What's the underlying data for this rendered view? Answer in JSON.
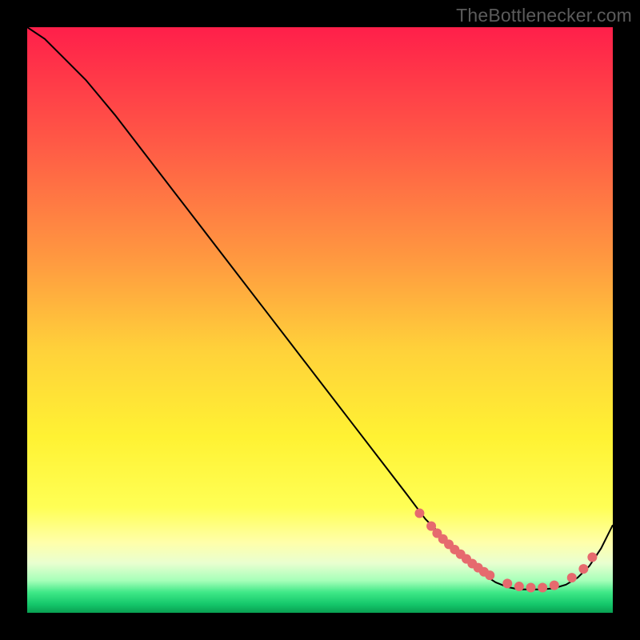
{
  "watermark": "TheBottlenecker.com",
  "colors": {
    "frame_bg": "#000000",
    "curve": "#000000",
    "dot_fill": "#e66a6e",
    "dot_stroke": "#e66a6e",
    "gradient_stops": [
      {
        "offset": 0.0,
        "color": "#ff1f4a"
      },
      {
        "offset": 0.2,
        "color": "#ff5a46"
      },
      {
        "offset": 0.4,
        "color": "#ff9a40"
      },
      {
        "offset": 0.55,
        "color": "#ffd13a"
      },
      {
        "offset": 0.7,
        "color": "#fff233"
      },
      {
        "offset": 0.82,
        "color": "#ffff55"
      },
      {
        "offset": 0.88,
        "color": "#ffffaa"
      },
      {
        "offset": 0.915,
        "color": "#e9ffd0"
      },
      {
        "offset": 0.945,
        "color": "#a6ffb9"
      },
      {
        "offset": 0.965,
        "color": "#3fe887"
      },
      {
        "offset": 0.985,
        "color": "#15c86b"
      },
      {
        "offset": 1.0,
        "color": "#0aa052"
      }
    ]
  },
  "chart_data": {
    "type": "line",
    "title": "",
    "xlabel": "",
    "ylabel": "",
    "xlim": [
      0,
      100
    ],
    "ylim": [
      0,
      100
    ],
    "series": [
      {
        "name": "bottleneck-curve",
        "x": [
          0,
          3,
          6,
          10,
          15,
          20,
          25,
          30,
          35,
          40,
          45,
          50,
          55,
          60,
          65,
          68,
          72,
          75,
          78,
          80,
          82,
          84,
          86,
          88,
          90,
          92,
          94,
          96,
          98,
          100
        ],
        "y": [
          100,
          98,
          95,
          91,
          85,
          78.5,
          72,
          65.5,
          59,
          52.5,
          46,
          39.5,
          33,
          26.5,
          20,
          16,
          12,
          9,
          6.5,
          5.2,
          4.4,
          4.0,
          4.0,
          4.0,
          4.2,
          4.8,
          6.0,
          8.0,
          11,
          15
        ]
      }
    ],
    "dots": {
      "name": "highlight-dots",
      "points": [
        {
          "x": 67,
          "y": 17.0
        },
        {
          "x": 69,
          "y": 14.8
        },
        {
          "x": 70,
          "y": 13.6
        },
        {
          "x": 71,
          "y": 12.6
        },
        {
          "x": 72,
          "y": 11.7
        },
        {
          "x": 73,
          "y": 10.8
        },
        {
          "x": 74,
          "y": 10.0
        },
        {
          "x": 75,
          "y": 9.2
        },
        {
          "x": 76,
          "y": 8.4
        },
        {
          "x": 77,
          "y": 7.7
        },
        {
          "x": 78,
          "y": 7.0
        },
        {
          "x": 79,
          "y": 6.4
        },
        {
          "x": 82,
          "y": 5.0
        },
        {
          "x": 84,
          "y": 4.5
        },
        {
          "x": 86,
          "y": 4.3
        },
        {
          "x": 88,
          "y": 4.3
        },
        {
          "x": 90,
          "y": 4.7
        },
        {
          "x": 93,
          "y": 6.0
        },
        {
          "x": 95,
          "y": 7.5
        },
        {
          "x": 96.5,
          "y": 9.5
        }
      ]
    }
  }
}
